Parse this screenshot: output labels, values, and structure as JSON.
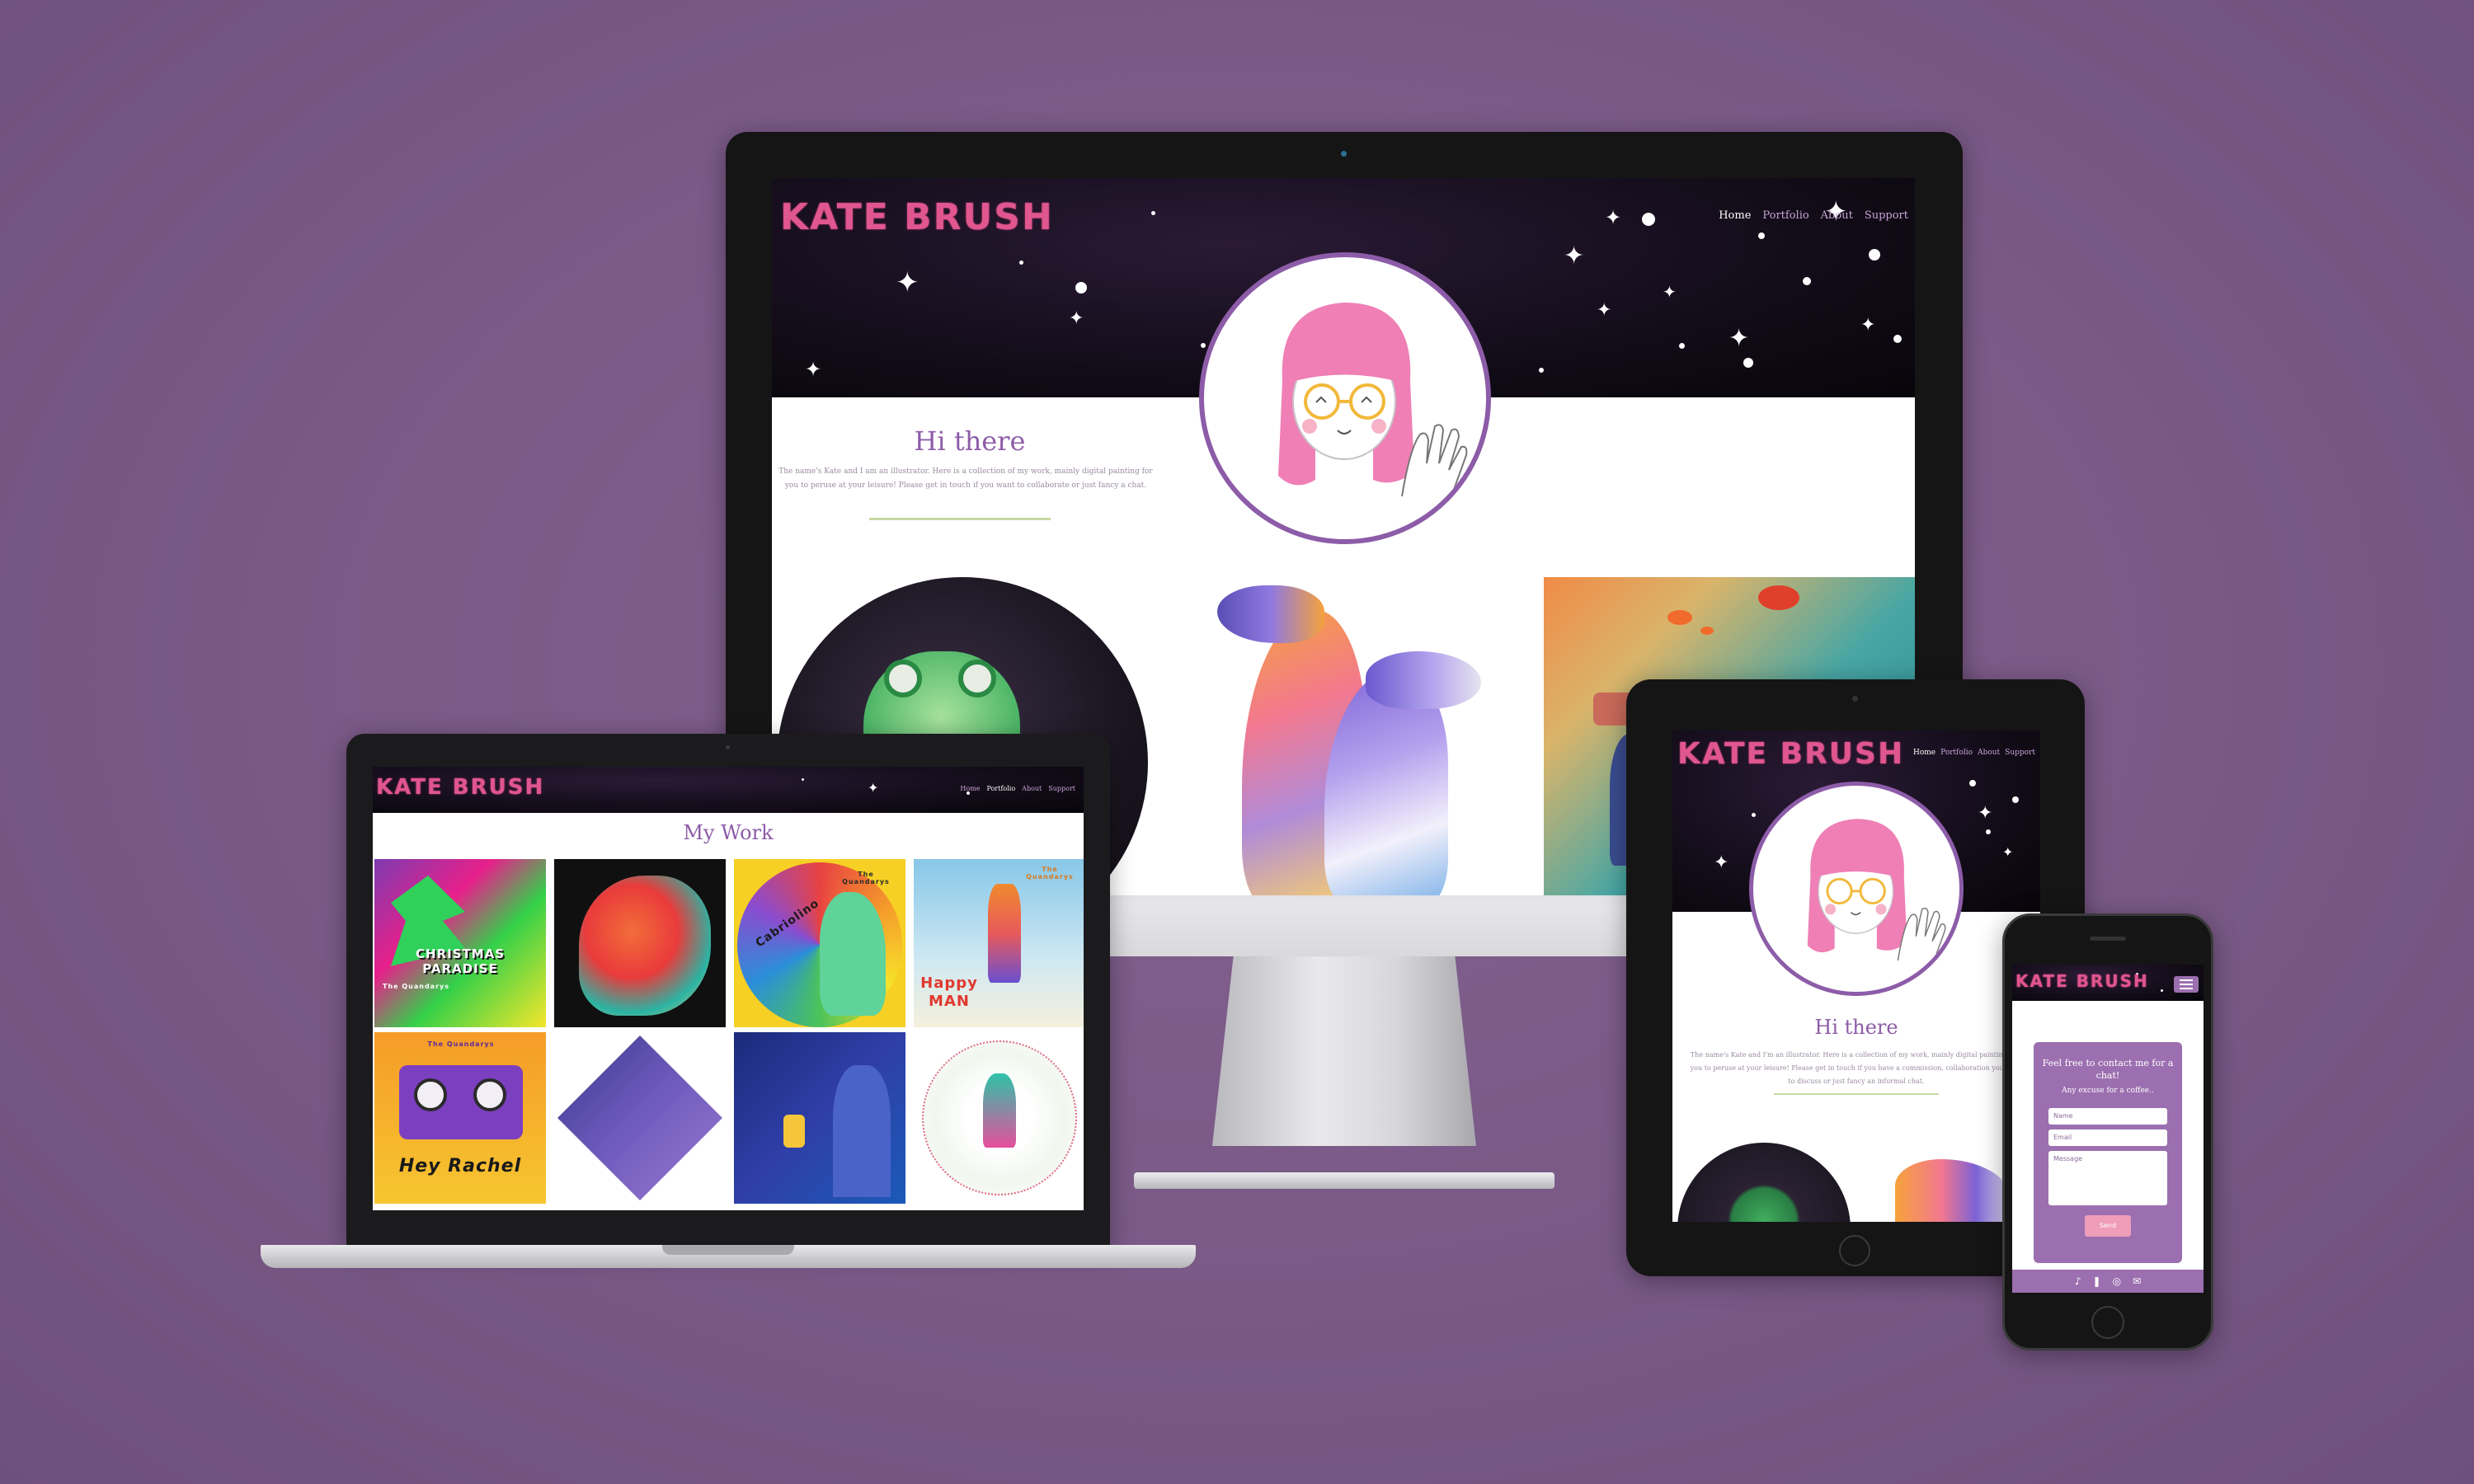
{
  "site": {
    "logo": "KATE BRUSH",
    "nav": [
      "Home",
      "Portfolio",
      "About",
      "Support"
    ],
    "hi_title": "Hi there",
    "hi_text_desktop": "The name's Kate and I am an illustrator. Here is a collection of my work, mainly digital painting for you to peruse at your leisure! Please get in touch if you want to collaborate or just fancy a chat.",
    "hi_text_tablet": "The name's Kate and I'm an illustrator. Here is a collection of my work, mainly digital paintings for you to peruse at your leisure! Please get in touch if you have a commission, collaboration you want to discuss or just fancy an informal chat.",
    "my_work_title": "My Work"
  },
  "gallery": {
    "tile1": {
      "title": "CHRISTMAS PARADISE",
      "band": "The Quandarys"
    },
    "tile3": {
      "title": "Cabriolino",
      "band": "The Quandarys"
    },
    "tile4": {
      "title": "Happy MAN",
      "band": "The Quandarys"
    },
    "tile5": {
      "title": "Hey Rachel",
      "band": "The Quandarys"
    }
  },
  "contact": {
    "heading": "Feel free to contact me for a chat!",
    "subheading": "Any excuse for a coffee..",
    "name_placeholder": "Name",
    "email_placeholder": "Email",
    "message_placeholder": "Message",
    "send_label": "Send"
  },
  "footer_icons": [
    "tiktok-icon",
    "patreon-icon",
    "instagram-icon",
    "email-icon"
  ],
  "colors": {
    "background": "#7a5987",
    "accent": "#8d5ca8",
    "logo_pink": "#e0568f",
    "divider_green": "#c8d9a4",
    "send_pink": "#ef9db9"
  }
}
